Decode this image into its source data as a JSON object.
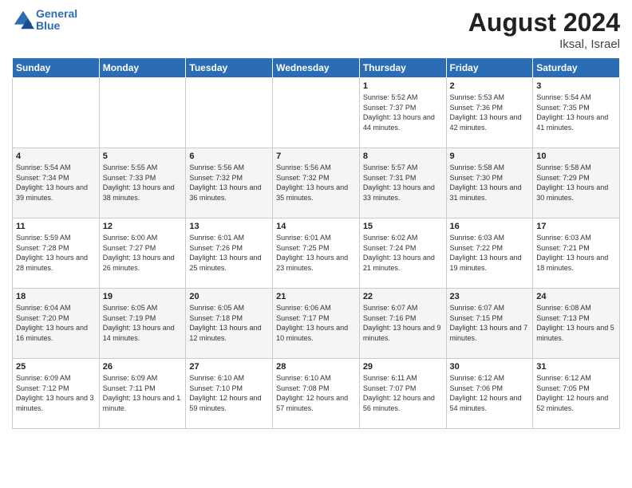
{
  "logo": {
    "text_general": "General",
    "text_blue": "Blue"
  },
  "header": {
    "month_year": "August 2024",
    "location": "Iksal, Israel"
  },
  "days_of_week": [
    "Sunday",
    "Monday",
    "Tuesday",
    "Wednesday",
    "Thursday",
    "Friday",
    "Saturday"
  ],
  "weeks": [
    [
      {
        "day": "",
        "info": ""
      },
      {
        "day": "",
        "info": ""
      },
      {
        "day": "",
        "info": ""
      },
      {
        "day": "",
        "info": ""
      },
      {
        "day": "1",
        "sunrise": "5:52 AM",
        "sunset": "7:37 PM",
        "daylight": "13 hours and 44 minutes."
      },
      {
        "day": "2",
        "sunrise": "5:53 AM",
        "sunset": "7:36 PM",
        "daylight": "13 hours and 42 minutes."
      },
      {
        "day": "3",
        "sunrise": "5:54 AM",
        "sunset": "7:35 PM",
        "daylight": "13 hours and 41 minutes."
      }
    ],
    [
      {
        "day": "4",
        "sunrise": "5:54 AM",
        "sunset": "7:34 PM",
        "daylight": "13 hours and 39 minutes."
      },
      {
        "day": "5",
        "sunrise": "5:55 AM",
        "sunset": "7:33 PM",
        "daylight": "13 hours and 38 minutes."
      },
      {
        "day": "6",
        "sunrise": "5:56 AM",
        "sunset": "7:32 PM",
        "daylight": "13 hours and 36 minutes."
      },
      {
        "day": "7",
        "sunrise": "5:56 AM",
        "sunset": "7:32 PM",
        "daylight": "13 hours and 35 minutes."
      },
      {
        "day": "8",
        "sunrise": "5:57 AM",
        "sunset": "7:31 PM",
        "daylight": "13 hours and 33 minutes."
      },
      {
        "day": "9",
        "sunrise": "5:58 AM",
        "sunset": "7:30 PM",
        "daylight": "13 hours and 31 minutes."
      },
      {
        "day": "10",
        "sunrise": "5:58 AM",
        "sunset": "7:29 PM",
        "daylight": "13 hours and 30 minutes."
      }
    ],
    [
      {
        "day": "11",
        "sunrise": "5:59 AM",
        "sunset": "7:28 PM",
        "daylight": "13 hours and 28 minutes."
      },
      {
        "day": "12",
        "sunrise": "6:00 AM",
        "sunset": "7:27 PM",
        "daylight": "13 hours and 26 minutes."
      },
      {
        "day": "13",
        "sunrise": "6:01 AM",
        "sunset": "7:26 PM",
        "daylight": "13 hours and 25 minutes."
      },
      {
        "day": "14",
        "sunrise": "6:01 AM",
        "sunset": "7:25 PM",
        "daylight": "13 hours and 23 minutes."
      },
      {
        "day": "15",
        "sunrise": "6:02 AM",
        "sunset": "7:24 PM",
        "daylight": "13 hours and 21 minutes."
      },
      {
        "day": "16",
        "sunrise": "6:03 AM",
        "sunset": "7:22 PM",
        "daylight": "13 hours and 19 minutes."
      },
      {
        "day": "17",
        "sunrise": "6:03 AM",
        "sunset": "7:21 PM",
        "daylight": "13 hours and 18 minutes."
      }
    ],
    [
      {
        "day": "18",
        "sunrise": "6:04 AM",
        "sunset": "7:20 PM",
        "daylight": "13 hours and 16 minutes."
      },
      {
        "day": "19",
        "sunrise": "6:05 AM",
        "sunset": "7:19 PM",
        "daylight": "13 hours and 14 minutes."
      },
      {
        "day": "20",
        "sunrise": "6:05 AM",
        "sunset": "7:18 PM",
        "daylight": "13 hours and 12 minutes."
      },
      {
        "day": "21",
        "sunrise": "6:06 AM",
        "sunset": "7:17 PM",
        "daylight": "13 hours and 10 minutes."
      },
      {
        "day": "22",
        "sunrise": "6:07 AM",
        "sunset": "7:16 PM",
        "daylight": "13 hours and 9 minutes."
      },
      {
        "day": "23",
        "sunrise": "6:07 AM",
        "sunset": "7:15 PM",
        "daylight": "13 hours and 7 minutes."
      },
      {
        "day": "24",
        "sunrise": "6:08 AM",
        "sunset": "7:13 PM",
        "daylight": "13 hours and 5 minutes."
      }
    ],
    [
      {
        "day": "25",
        "sunrise": "6:09 AM",
        "sunset": "7:12 PM",
        "daylight": "13 hours and 3 minutes."
      },
      {
        "day": "26",
        "sunrise": "6:09 AM",
        "sunset": "7:11 PM",
        "daylight": "13 hours and 1 minute."
      },
      {
        "day": "27",
        "sunrise": "6:10 AM",
        "sunset": "7:10 PM",
        "daylight": "12 hours and 59 minutes."
      },
      {
        "day": "28",
        "sunrise": "6:10 AM",
        "sunset": "7:08 PM",
        "daylight": "12 hours and 57 minutes."
      },
      {
        "day": "29",
        "sunrise": "6:11 AM",
        "sunset": "7:07 PM",
        "daylight": "12 hours and 56 minutes."
      },
      {
        "day": "30",
        "sunrise": "6:12 AM",
        "sunset": "7:06 PM",
        "daylight": "12 hours and 54 minutes."
      },
      {
        "day": "31",
        "sunrise": "6:12 AM",
        "sunset": "7:05 PM",
        "daylight": "12 hours and 52 minutes."
      }
    ]
  ],
  "labels": {
    "sunrise": "Sunrise:",
    "sunset": "Sunset:",
    "daylight": "Daylight:"
  }
}
